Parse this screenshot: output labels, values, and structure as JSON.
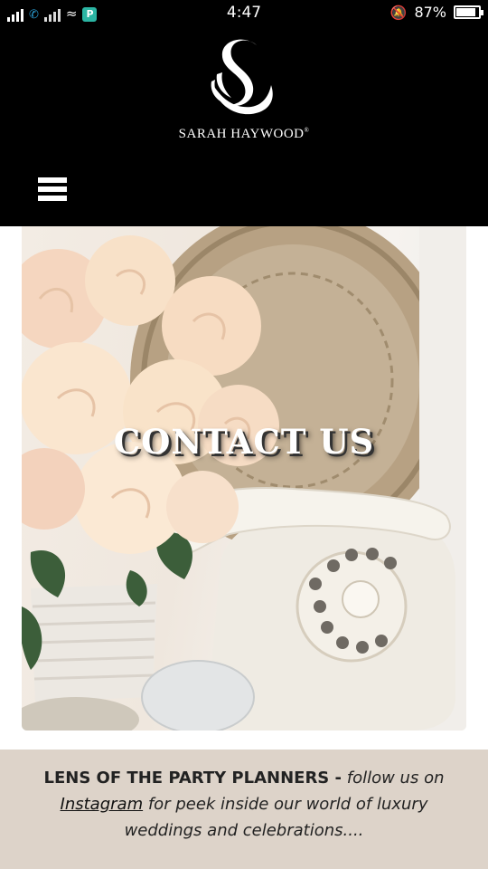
{
  "status_bar": {
    "time": "4:47",
    "battery_percent": "87%",
    "battery_level": 0.87,
    "app_badge": "P"
  },
  "header": {
    "brand": "SARAH HAYWOOD",
    "brand_mark": "®",
    "logo_icon": "swan-logo",
    "menu_icon": "hamburger-menu-icon"
  },
  "hero": {
    "title": "CONTACT US"
  },
  "promo": {
    "heading": "LENS OF THE PARTY PLANNERS -",
    "text_1": "follow us on",
    "link": "Instagram",
    "text_2": "for peek inside our world of luxury",
    "text_3": "weddings and celebrations...."
  },
  "colors": {
    "header_bg": "#000000",
    "promo_bg": "#ddd3c9"
  }
}
